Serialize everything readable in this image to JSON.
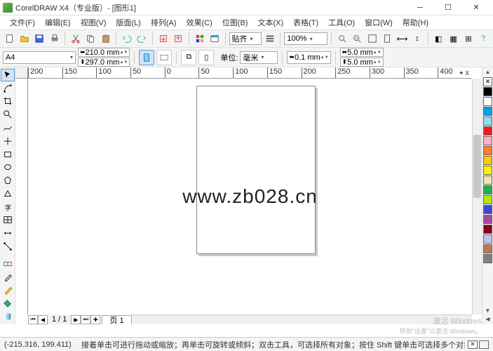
{
  "title": "CorelDRAW X4（专业版）- [图形1]",
  "menu": [
    "文件(F)",
    "编辑(E)",
    "视图(V)",
    "版面(L)",
    "排列(A)",
    "效果(C)",
    "位图(B)",
    "文本(X)",
    "表格(T)",
    "工具(O)",
    "窗口(W)",
    "帮助(H)"
  ],
  "zoom": "100%",
  "snap_label": "贴齐",
  "paper": "A4",
  "dims": {
    "w": "210.0 mm",
    "h": "297.0 mm"
  },
  "unit_label": "单位:",
  "unit": "毫米",
  "nudge": "0.1 mm",
  "dup": {
    "x": "5.0 mm",
    "y": "5.0 mm"
  },
  "ruler_h": [
    "200",
    "150",
    "100",
    "50",
    "0",
    "50",
    "100",
    "150",
    "200",
    "250",
    "300",
    "350",
    "400"
  ],
  "watermark": "www.zb028.cn",
  "pager": {
    "pos": "1 / 1",
    "tab": "页 1"
  },
  "status": {
    "coord": "(-215.316, 199.411)",
    "hint": "接着单击可进行拖动或缩放；再单击可旋转或倾斜；双击工具，可选择所有对象；按住 Shift 键单击可选择多个对象；按住 Alt 键单"
  },
  "activation": {
    "l1": "激活 Windows",
    "l2": "转到\"设置\"以激活 Windows。"
  },
  "palette": [
    "#000",
    "#fff",
    "#00a2e8",
    "#99d9ea",
    "#ed1c24",
    "#ffaec9",
    "#ff7f27",
    "#ffc90e",
    "#fff200",
    "#efe4b0",
    "#22b14c",
    "#b5e61d",
    "#3f48cc",
    "#a349a4",
    "#880015",
    "#c8bfe7",
    "#b97a57",
    "#808080"
  ],
  "hint_xy": "x"
}
